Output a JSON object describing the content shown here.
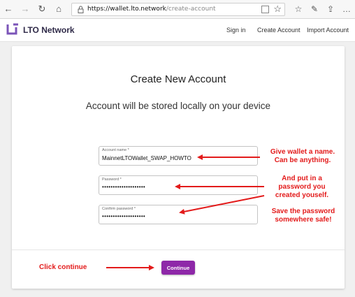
{
  "browser": {
    "url_host": "https://wallet.lto.network",
    "url_path": "/create-account",
    "icons": [
      "back-icon",
      "forward-icon",
      "refresh-icon",
      "home-icon",
      "lock-icon",
      "reader-view-icon",
      "favorite-star-icon",
      "favorites-list-icon",
      "pen-icon",
      "share-icon"
    ]
  },
  "header": {
    "brand": "LTO Network",
    "nav": {
      "sign_in": "Sign in",
      "create_account": "Create Account",
      "import_account": "Import Account"
    }
  },
  "form": {
    "title": "Create New Account",
    "subtitle": "Account will be stored locally on your device",
    "account_name": {
      "label": "Account name *",
      "value": "MainnetLTOWallet_SWAP_HOWTO"
    },
    "password": {
      "label": "Password *",
      "value": "••••••••••••••••••••"
    },
    "confirm_password": {
      "label": "Confirm password *",
      "value": "••••••••••••••••••••"
    },
    "continue_label": "Continue"
  },
  "annotations": {
    "name_line1": "Give wallet a name.",
    "name_line2": "Can be anything.",
    "password_line1": "And put in a",
    "password_line2": "password you",
    "password_line3": "created youself.",
    "save_line1": "Save the password",
    "save_line2": "somewhere safe!",
    "continue": "Click continue"
  },
  "colors": {
    "accent": "#8e28a8",
    "annotation": "#e31b1b",
    "brand": "#2f2a48"
  }
}
